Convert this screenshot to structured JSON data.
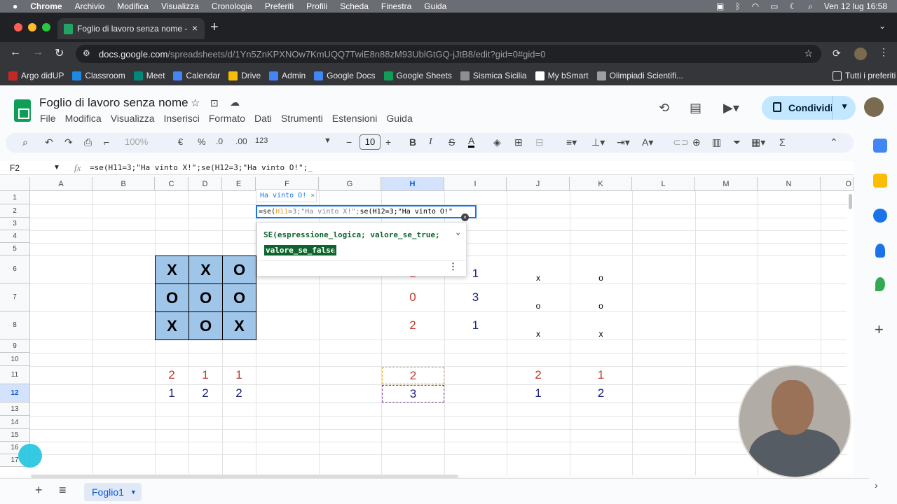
{
  "macbar": {
    "app": "Chrome",
    "menus": [
      "Archivio",
      "Modifica",
      "Visualizza",
      "Cronologia",
      "Preferiti",
      "Profili",
      "Scheda",
      "Finestra",
      "Guida"
    ],
    "datetime": "Ven 12 lug  16:58"
  },
  "browser": {
    "tab_title": "Foglio di lavoro senza nome -",
    "url_host": "docs.google.com",
    "url_path": "/spreadsheets/d/1Yn5ZnKPXNOw7KmUQQ7TwiE8n88zM93UblGtGQ-jJtB8/edit?gid=0#gid=0"
  },
  "bookmarks": [
    {
      "label": "Argo didUP",
      "color": "#c62828"
    },
    {
      "label": "Classroom",
      "color": "#1e88e5"
    },
    {
      "label": "Meet",
      "color": "#00897b"
    },
    {
      "label": "Calendar",
      "color": "#4285f4"
    },
    {
      "label": "Drive",
      "color": "#fbbc04"
    },
    {
      "label": "Admin",
      "color": "#4285f4"
    },
    {
      "label": "Google Docs",
      "color": "#4285f4"
    },
    {
      "label": "Google Sheets",
      "color": "#0f9d58"
    },
    {
      "label": "Sismica Sicilia",
      "color": "#8e8e8e"
    },
    {
      "label": "My bSmart",
      "color": "#ffffff"
    },
    {
      "label": "Olimpiadi Scientifi...",
      "color": "#9e9e9e"
    }
  ],
  "bookmarks_all": "Tutti i preferiti",
  "doc": {
    "title": "Foglio di lavoro senza nome",
    "menus": [
      "File",
      "Modifica",
      "Visualizza",
      "Inserisci",
      "Formato",
      "Dati",
      "Strumenti",
      "Estensioni",
      "Guida"
    ],
    "share": "Condividi"
  },
  "toolbar": {
    "zoom": "100%",
    "currency": "€",
    "percent": "%",
    "dec_minus": ".0",
    "dec_plus": ".00",
    "format": "123",
    "font_size": "10"
  },
  "formula_bar": {
    "cell": "F2",
    "formula": "=se(H11=3;\"Ha vinto X!\";se(H12=3;\"Ha vinto O!\";_"
  },
  "columns": [
    "A",
    "B",
    "C",
    "D",
    "E",
    "F",
    "G",
    "H",
    "I",
    "J",
    "K",
    "L",
    "M",
    "N",
    "O"
  ],
  "rows": [
    "1",
    "2",
    "3",
    "4",
    "5",
    "6",
    "7",
    "8",
    "9",
    "10",
    "11",
    "12",
    "13",
    "14",
    "15",
    "16",
    "17"
  ],
  "board": [
    [
      "X",
      "X",
      "O"
    ],
    [
      "O",
      "O",
      "O"
    ],
    [
      "X",
      "O",
      "X"
    ]
  ],
  "col_h": [
    "2",
    "0",
    "2"
  ],
  "col_i": [
    "1",
    "3",
    "1"
  ],
  "col_j": [
    "x",
    "o",
    "x"
  ],
  "col_k": [
    "o",
    "o",
    "x"
  ],
  "row11": {
    "c": "2",
    "d": "1",
    "e": "1",
    "h": "2",
    "j": "2",
    "k": "1"
  },
  "row12": {
    "c": "1",
    "d": "2",
    "e": "2",
    "h": "3",
    "j": "1",
    "k": "2"
  },
  "editor": {
    "hint": "Ha vinto O!",
    "p1": "=se(",
    "p2": "H11",
    "p3": "=3;\"Ha vinto X!\";",
    "p4": "se(H12=3;\"Ha vinto O!\""
  },
  "help": {
    "signature": "SE(espressione_logica; valore_se_true;",
    "current_arg": "valore_se_false",
    "close_paren": ")"
  },
  "sheet": {
    "name": "Foglio1"
  }
}
